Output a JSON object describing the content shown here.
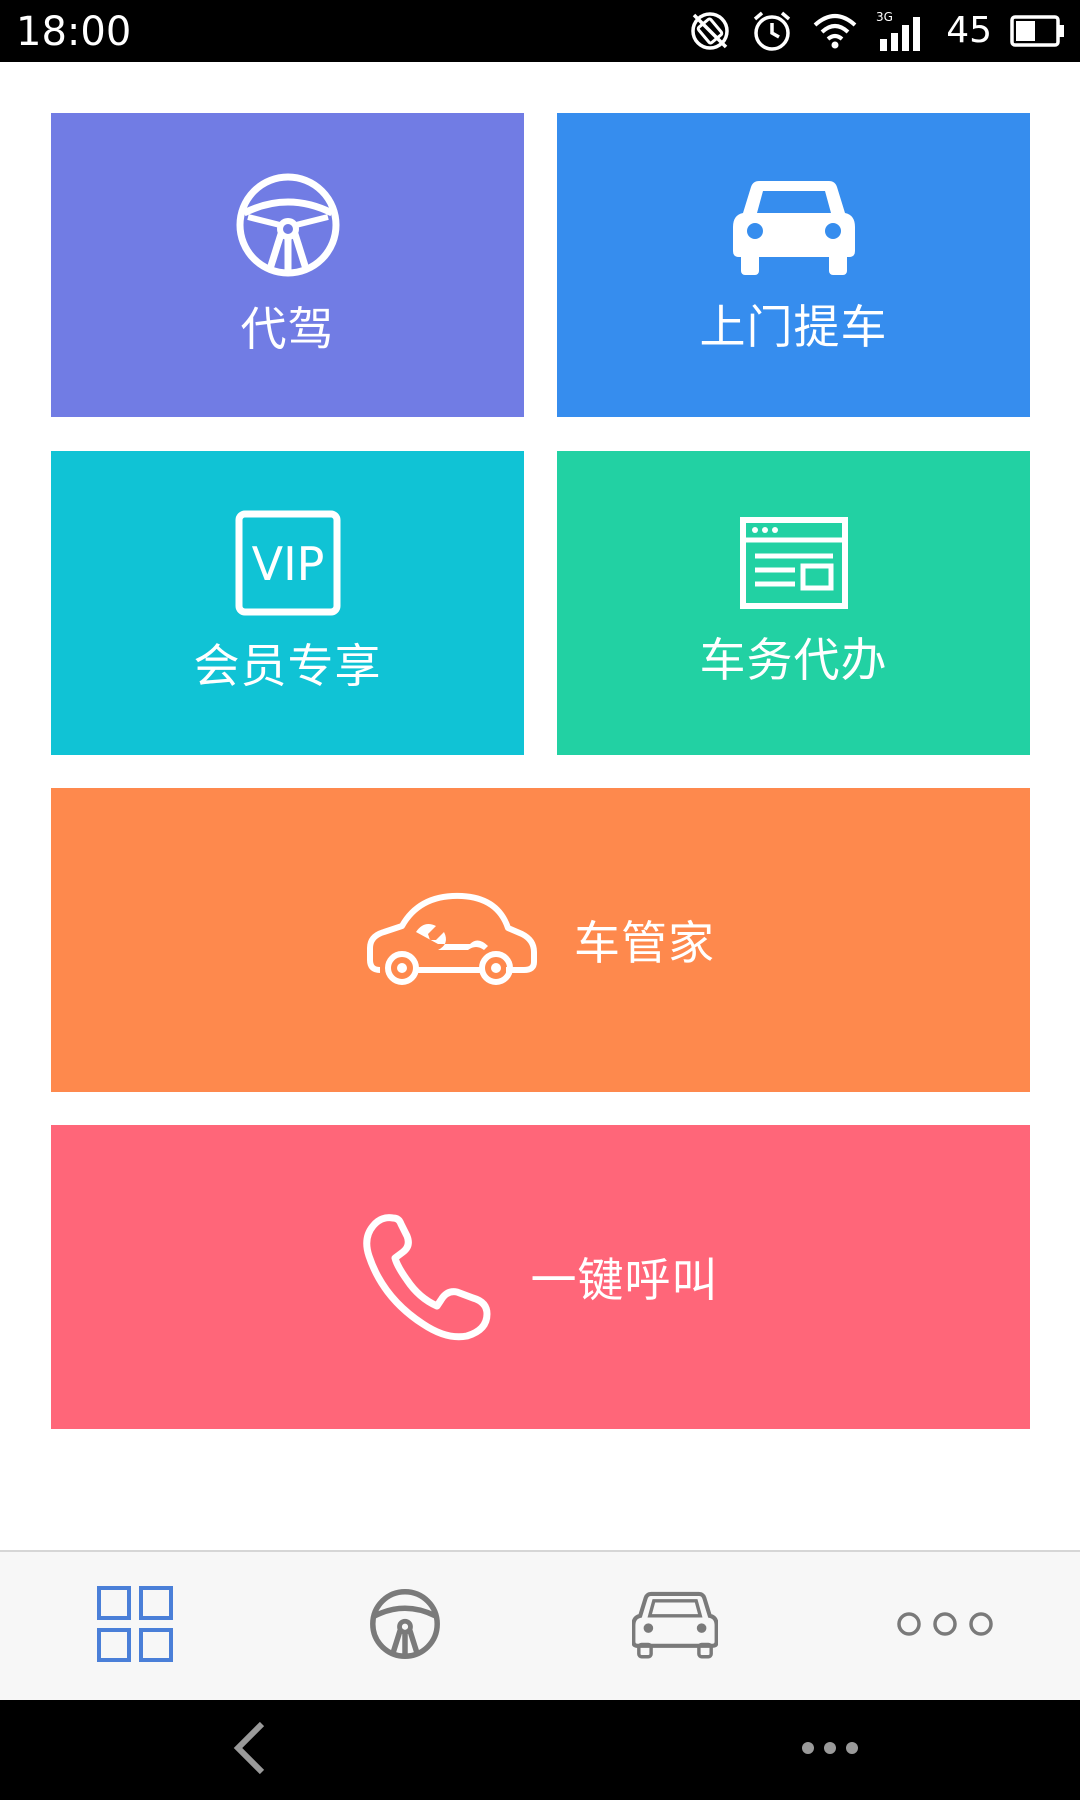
{
  "status_bar": {
    "time": "18:00",
    "battery_level": "45",
    "network": "3G"
  },
  "tiles": {
    "daijia": {
      "label": "代驾",
      "color": "#717CE4",
      "icon": "steering-wheel-icon"
    },
    "pickup": {
      "label": "上门提车",
      "color": "#368DEE",
      "icon": "car-icon"
    },
    "vip": {
      "label": "会员专享",
      "color": "#10C3D5",
      "icon": "vip-icon",
      "icon_text": "VIP"
    },
    "errands": {
      "label": "车务代办",
      "color": "#22D1A3",
      "icon": "browser-window-icon"
    },
    "steward": {
      "label": "车管家",
      "color": "#FE894D",
      "icon": "car-wrench-icon"
    },
    "call": {
      "label": "一键呼叫",
      "color": "#FF6679",
      "icon": "phone-icon"
    }
  },
  "tab_bar": {
    "items": [
      {
        "icon": "grid-icon",
        "active": true,
        "color": "#4A7FD8"
      },
      {
        "icon": "steering-wheel-icon",
        "active": false,
        "color": "#7A7A7A"
      },
      {
        "icon": "car-icon",
        "active": false,
        "color": "#7A7A7A"
      },
      {
        "icon": "more-dots-icon",
        "active": false,
        "color": "#7A7A7A"
      }
    ]
  },
  "nav_bar": {
    "items": [
      {
        "icon": "back-icon"
      },
      {
        "icon": "menu-dots-icon"
      }
    ]
  }
}
